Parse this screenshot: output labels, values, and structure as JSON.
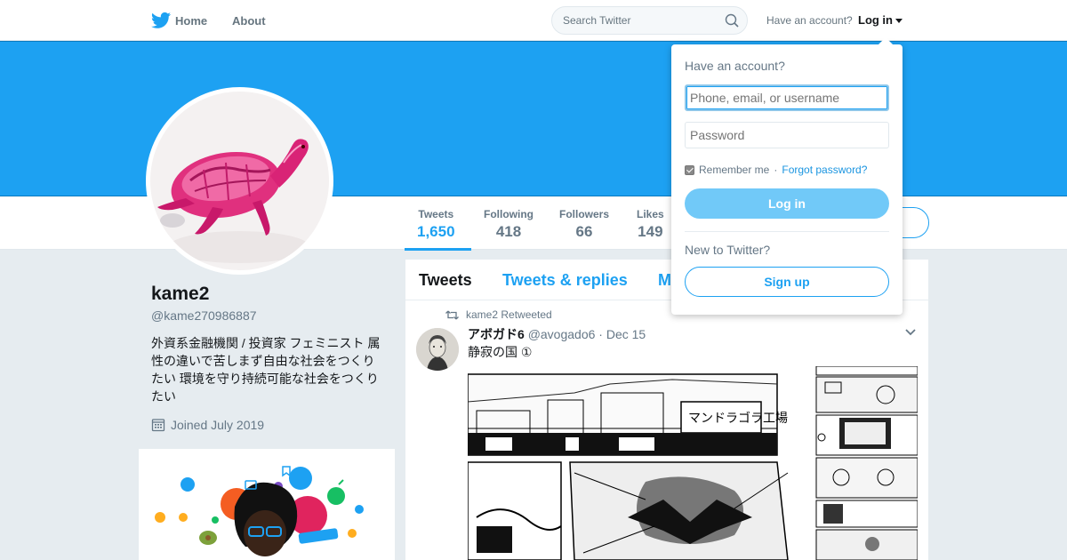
{
  "nav": {
    "home_label": "Home",
    "about_label": "About",
    "search_placeholder": "Search Twitter",
    "have_account": "Have an account?",
    "login_label": "Log in"
  },
  "profile": {
    "name": "kame2",
    "handle": "@kame270986887",
    "bio": "外資系金融機関 / 投資家 フェミニスト 属性の違いで苦しまず自由な社会をつくりたい 環境を守り持続可能な社会をつくりたい",
    "joined": "Joined July 2019",
    "stats": [
      {
        "label": "Tweets",
        "value": "1,650"
      },
      {
        "label": "Following",
        "value": "418"
      },
      {
        "label": "Followers",
        "value": "66"
      },
      {
        "label": "Likes",
        "value": "149"
      }
    ]
  },
  "timeline": {
    "tabs": [
      "Tweets",
      "Tweets & replies",
      "M"
    ],
    "retweet_line": "kame2 Retweeted",
    "tweet": {
      "author_name": "アボガド6",
      "author_handle": "@avogado6",
      "date": "· Dec 15",
      "text": "静寂の国 ①",
      "sign_text": "マンドラゴラ工場"
    }
  },
  "login_dropdown": {
    "title": "Have an account?",
    "username_placeholder": "Phone, email, or username",
    "password_placeholder": "Password",
    "remember_me": "Remember me",
    "separator": "·",
    "forgot_password": "Forgot password?",
    "login_button": "Log in",
    "new_to_twitter": "New to Twitter?",
    "signup_button": "Sign up"
  },
  "colors": {
    "brand_blue": "#1da1f2",
    "login_button": "#71c9f8",
    "background": "#e6ecf0"
  }
}
